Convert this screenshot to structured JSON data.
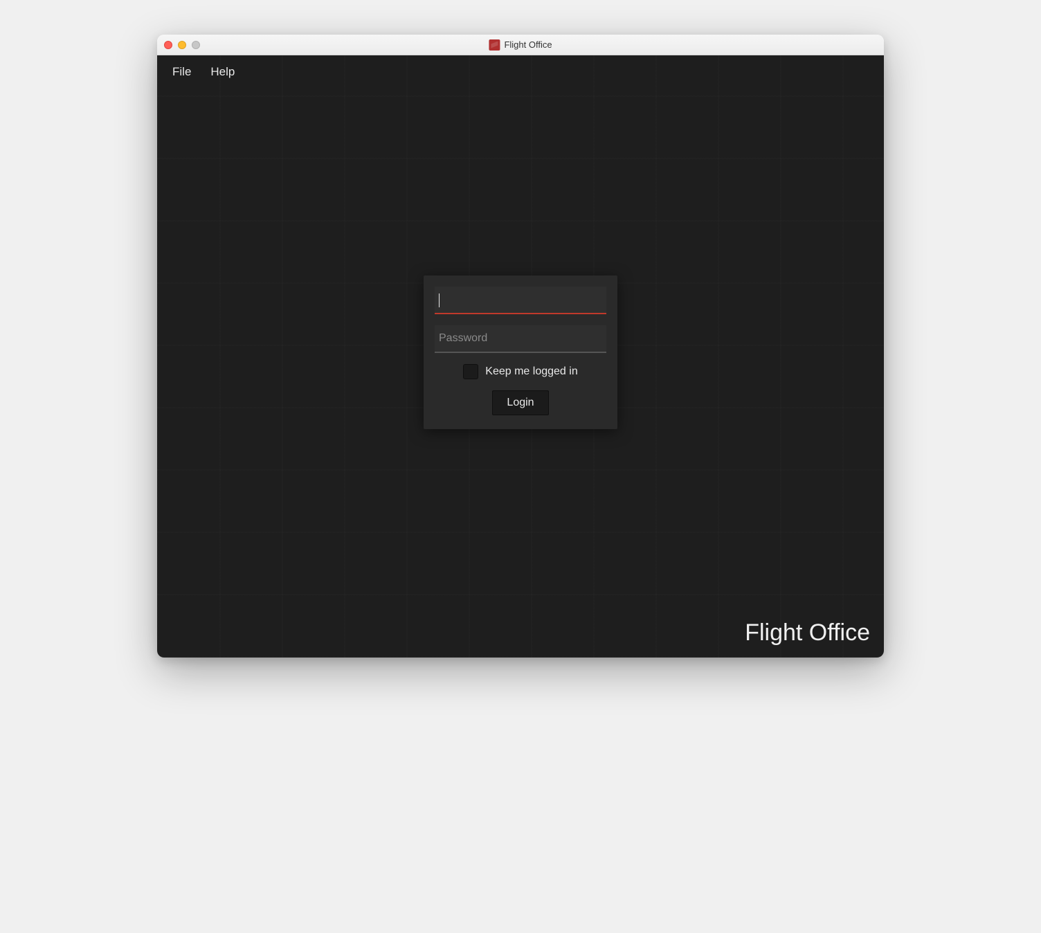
{
  "window": {
    "title": "Flight Office"
  },
  "menu": {
    "file": "File",
    "help": "Help"
  },
  "login": {
    "username_value": "",
    "username_placeholder": "",
    "password_value": "",
    "password_placeholder": "Password",
    "keep_logged_in_label": "Keep me logged in",
    "keep_logged_in_checked": false,
    "login_button": "Login"
  },
  "watermark": "Flight Office",
  "colors": {
    "bg": "#1e1e1e",
    "panel": "#2a2a2a",
    "accent_underline": "#c0392b"
  }
}
